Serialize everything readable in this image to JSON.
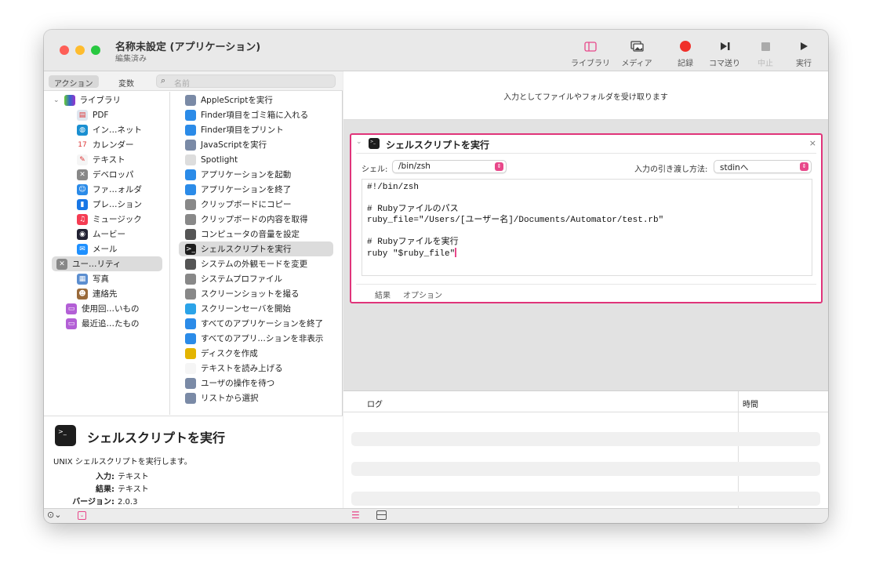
{
  "window": {
    "title": "名称未設定 (アプリケーション)",
    "subtitle": "編集済み"
  },
  "toolbar": [
    {
      "label": "ライブラリ",
      "icon": "sidebar-icon"
    },
    {
      "label": "メディア",
      "icon": "photos-icon"
    },
    {
      "label": "記録",
      "icon": "record-icon"
    },
    {
      "label": "コマ送り",
      "icon": "step-icon"
    },
    {
      "label": "中止",
      "icon": "stop-icon"
    },
    {
      "label": "実行",
      "icon": "play-icon"
    }
  ],
  "left": {
    "tabs": [
      "アクション",
      "変数"
    ],
    "search_placeholder": "名前",
    "library": {
      "label": "ライブラリ",
      "items": [
        "PDF",
        "イン…ネット",
        "カレンダー",
        "テキスト",
        "デベロッパ",
        "ファ…ォルダ",
        "プレ…ション",
        "ミュージック",
        "ムービー",
        "メール",
        "ユー…リティ",
        "写真",
        "連絡先"
      ],
      "selected": 10
    },
    "folders": [
      "使用回…いもの",
      "最近追…たもの"
    ],
    "actions": [
      "AppleScriptを実行",
      "Finder項目をゴミ箱に入れる",
      "Finder項目をプリント",
      "JavaScriptを実行",
      "Spotlight",
      "アプリケーションを起動",
      "アプリケーションを終了",
      "クリップボードにコピー",
      "クリップボードの内容を取得",
      "コンピュータの音量を設定",
      "シェルスクリプトを実行",
      "システムの外観モードを変更",
      "システムプロファイル",
      "スクリーンショットを撮る",
      "スクリーンセーバを開始",
      "すべてのアプリケーションを終了",
      "すべてのアプリ…ションを非表示",
      "ディスクを作成",
      "テキストを読み上げる",
      "ユーザの操作を待つ",
      "リストから選択"
    ],
    "actions_selected": 10,
    "description": {
      "title": "シェルスクリプトを実行",
      "text": "UNIX シェルスクリプトを実行します。",
      "input_label": "入力:",
      "input": "テキスト",
      "result_label": "結果:",
      "result": "テキスト",
      "version_label": "バージョン:",
      "version": "2.0.3"
    }
  },
  "workflow": {
    "input_info": "入力としてファイルやフォルダを受け取ります",
    "action": {
      "title": "シェルスクリプトを実行",
      "shell_label": "シェル:",
      "shell": "/bin/zsh",
      "pass_label": "入力の引き渡し方法:",
      "pass": "stdinへ",
      "code": [
        "#!/bin/zsh",
        "",
        "# Rubyファイルのパス",
        "ruby_file=\"/Users/[ユーザー名]/Documents/Automator/test.rb\"",
        "",
        "# Rubyファイルを実行",
        "ruby \"$ruby_file\""
      ],
      "tabs": [
        "結果",
        "オプション"
      ]
    }
  },
  "log": {
    "columns": [
      "ログ",
      "時間"
    ]
  },
  "colors": {
    "accent": "#e0347a",
    "record": "#f0302a"
  }
}
